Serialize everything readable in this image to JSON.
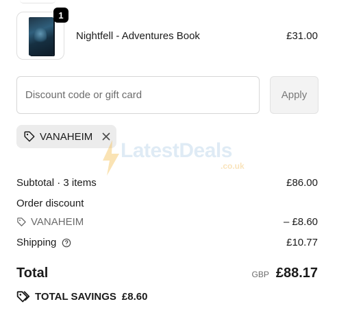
{
  "product": {
    "name": "Nightfell - Adventures Book",
    "price": "£31.00",
    "quantity": "1"
  },
  "discount": {
    "placeholder": "Discount code or gift card",
    "apply_label": "Apply",
    "applied_code": "VANAHEIM"
  },
  "watermark": {
    "brand": "LatestDeals",
    "domain": ".co.uk"
  },
  "summary": {
    "subtotal_label": "Subtotal · 3 items",
    "subtotal_value": "£86.00",
    "order_discount_label": "Order discount",
    "discount_code": "VANAHEIM",
    "discount_value": "– £8.60",
    "shipping_label": "Shipping",
    "shipping_value": "£10.77",
    "total_label": "Total",
    "currency": "GBP",
    "total_value": "£88.17",
    "savings_label": "TOTAL SAVINGS",
    "savings_value": "£8.60"
  },
  "icons": {
    "tag": "tag-icon",
    "close": "close-icon",
    "help": "help-circle-icon",
    "savings": "savings-tag-icon",
    "bolt": "lightning-bolt-icon"
  }
}
